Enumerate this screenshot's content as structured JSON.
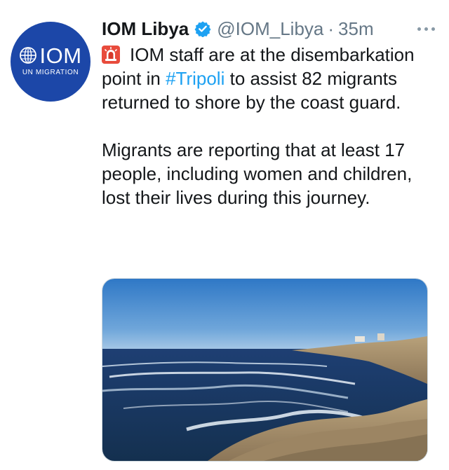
{
  "author": {
    "display_name": "IOM Libya",
    "handle": "@IOM_Libya",
    "separator": "·",
    "time": "35m",
    "verified": true,
    "avatar": {
      "logo_text": "IOM",
      "logo_subtext": "UN MIGRATION",
      "background": "#1c47a8"
    }
  },
  "tweet": {
    "emoji": "siren-icon",
    "line1_text": "IOM staff are at the disembarkation point in ",
    "hashtag": "#Tripoli",
    "line1_rest": " to assist 82 migrants returned to shore by the coast guard.",
    "paragraph2": "Migrants are reporting that at least 17 people, including women and children, lost their lives during this journey."
  },
  "media": {
    "alt": ""
  },
  "colors": {
    "link": "#1da1f2",
    "secondary": "#657786",
    "text": "#14171a",
    "verified": "#1da1f2"
  }
}
